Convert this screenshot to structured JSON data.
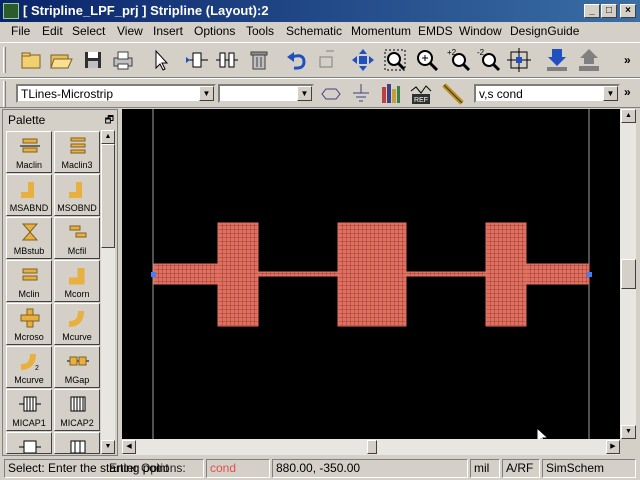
{
  "window": {
    "title": "[ Stripline_LPF_prj ] Stripline (Layout):2",
    "buttons": {
      "minimize": "_",
      "maximize": "□",
      "close": "×"
    }
  },
  "menu": {
    "items": [
      "File",
      "Edit",
      "Select",
      "View",
      "Insert",
      "Options",
      "Tools",
      "Schematic",
      "Momentum",
      "EMDS",
      "Window",
      "DesignGuide"
    ]
  },
  "toolbar": {
    "more_glyph": "»"
  },
  "toolbar2": {
    "library_combo": "TLines-Microstrip",
    "component_combo": "",
    "layer_combo": "v,s cond"
  },
  "palette": {
    "title": "Palette",
    "restore_glyph": "🗗",
    "items": [
      "Maclin",
      "Maclin3",
      "MSABND",
      "MSOBND",
      "MBstub",
      "Mcfil",
      "Mclin",
      "Mcorn",
      "Mcroso",
      "Mcurve",
      "Mcurve",
      "MGap",
      "MICAP1",
      "MICAP2"
    ]
  },
  "status": {
    "prompt": "Select: Enter the starting point",
    "hint": "Enter Options:",
    "layer": "cond",
    "coords": "880.00, -350.00",
    "units": "mil",
    "mode": "A/RF",
    "view": "SimSchem"
  },
  "colors": {
    "title_start": "#0a246a",
    "title_end": "#3a6ea5",
    "canvas_bg": "#000000",
    "trace_fill": "#e07060",
    "layer_text": "#e05050"
  },
  "icons": [
    "new-file-icon",
    "open-folder-icon",
    "save-icon",
    "print-icon",
    "select-arrow-icon",
    "insert-port-icon",
    "insert-component-icon",
    "delete-icon",
    "undo-icon",
    "move-icon",
    "pan-icon",
    "zoom-area-icon",
    "zoom-in-icon",
    "zoom-out-icon",
    "zoom-fit-icon",
    "push-into-icon",
    "pop-out-icon"
  ]
}
